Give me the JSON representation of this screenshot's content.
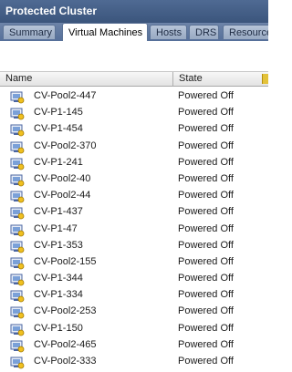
{
  "window": {
    "title": "Protected Cluster"
  },
  "tabs": [
    {
      "label": "Summary"
    },
    {
      "label": "Virtual Machines"
    },
    {
      "label": "Hosts"
    },
    {
      "label": "DRS"
    },
    {
      "label": "Resource"
    }
  ],
  "table": {
    "columns": {
      "name": "Name",
      "state": "State"
    },
    "rows": [
      {
        "name": "CV-Pool2-447",
        "state": "Powered Off"
      },
      {
        "name": "CV-P1-145",
        "state": "Powered Off"
      },
      {
        "name": "CV-P1-454",
        "state": "Powered Off"
      },
      {
        "name": "CV-Pool2-370",
        "state": "Powered Off"
      },
      {
        "name": "CV-P1-241",
        "state": "Powered Off"
      },
      {
        "name": "CV-Pool2-40",
        "state": "Powered Off"
      },
      {
        "name": "CV-Pool2-44",
        "state": "Powered Off"
      },
      {
        "name": "CV-P1-437",
        "state": "Powered Off"
      },
      {
        "name": "CV-P1-47",
        "state": "Powered Off"
      },
      {
        "name": "CV-P1-353",
        "state": "Powered Off"
      },
      {
        "name": "CV-Pool2-155",
        "state": "Powered Off"
      },
      {
        "name": "CV-P1-344",
        "state": "Powered Off"
      },
      {
        "name": "CV-P1-334",
        "state": "Powered Off"
      },
      {
        "name": "CV-Pool2-253",
        "state": "Powered Off"
      },
      {
        "name": "CV-P1-150",
        "state": "Powered Off"
      },
      {
        "name": "CV-Pool2-465",
        "state": "Powered Off"
      },
      {
        "name": "CV-Pool2-333",
        "state": "Powered Off"
      }
    ],
    "row_icon": "vm-powered-off-icon"
  }
}
